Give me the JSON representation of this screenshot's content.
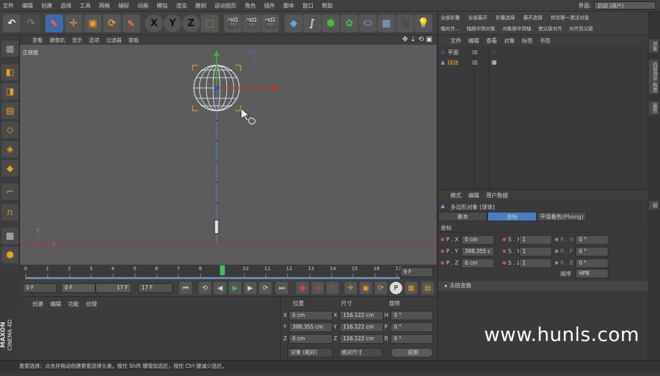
{
  "menu": [
    "文件",
    "编辑",
    "创建",
    "选择",
    "工具",
    "网格",
    "捕捉",
    "动画",
    "模拟",
    "渲染",
    "雕刻",
    "运动图形",
    "角色",
    "插件",
    "脚本",
    "窗口",
    "帮助"
  ],
  "interface": {
    "label": "界面:",
    "value": "启动 (用户)"
  },
  "toolbar_right": {
    "row1": [
      "全部折叠",
      "全部展开",
      "折叠选择",
      "展开选择",
      "转到第一激活对象"
    ],
    "row2": [
      "轴对齐...",
      "轴居中到对象",
      "对象居中到轴",
      "使父级对齐",
      "对齐到父级"
    ]
  },
  "viewport": {
    "menu": [
      "查看",
      "摄像机",
      "显示",
      "选项",
      "过滤器",
      "面板"
    ],
    "label": "正视图",
    "axis_y": "Y",
    "axis_x": "X"
  },
  "timeline": {
    "ticks": [
      "0",
      "1",
      "2",
      "3",
      "4",
      "5",
      "6",
      "7",
      "8",
      "9",
      "10",
      "11",
      "12",
      "13",
      "14",
      "15",
      "16",
      "17"
    ],
    "current": "9 F",
    "current_frame": 9
  },
  "transport": {
    "start": "0 F",
    "range_start": "0 F",
    "range_end": "17 F",
    "end": "17 F"
  },
  "material": {
    "menu": [
      "创建",
      "编辑",
      "功能",
      "纹理"
    ]
  },
  "coords": {
    "headers": [
      "位置",
      "尺寸",
      "旋转"
    ],
    "rows": [
      {
        "axis": "X",
        "pos": "0 cm",
        "size_axis": "X",
        "size": "116.122 cm",
        "rot_axis": "H",
        "rot": "0 °"
      },
      {
        "axis": "Y",
        "pos": "398.355 cm",
        "size_axis": "Y",
        "size": "116.122 cm",
        "rot_axis": "P",
        "rot": "0 °"
      },
      {
        "axis": "Z",
        "pos": "0 cm",
        "size_axis": "Z",
        "size": "116.122 cm",
        "rot_axis": "B",
        "rot": "0 °"
      }
    ],
    "mode1": "对象 (相对)",
    "mode2": "绝对尺寸",
    "apply": "应用"
  },
  "objects": {
    "menu": [
      "文件",
      "编辑",
      "查看",
      "对象",
      "标签",
      "书签"
    ],
    "items": [
      "平面",
      "球体"
    ]
  },
  "attributes": {
    "menu": [
      "模式",
      "编辑",
      "用户数据"
    ],
    "title": "多边形对象 [球体]",
    "tabs": [
      "基本",
      "坐标",
      "平滑着色(Phong)"
    ],
    "section": "坐标",
    "rows": [
      {
        "p": "P . X",
        "pv": "0 cm",
        "s": "S . X",
        "sv": "1",
        "r": "R . H",
        "rv": "0 °"
      },
      {
        "p": "P . Y",
        "pv": "398.355 c",
        "s": "S . Y",
        "sv": "1",
        "r": "R . P",
        "rv": "0 °"
      },
      {
        "p": "P . Z",
        "pv": "0 cm",
        "s": "S . Z",
        "sv": "1",
        "r": "R . B",
        "rv": "0 °"
      }
    ],
    "order_label": "顺序",
    "order_value": "HPB",
    "frozen": "冻结变换"
  },
  "right_tabs": [
    "对象",
    "内容浏览器",
    "构造",
    "属性",
    "层"
  ],
  "status": "套索选择：点击并拖动创建套索选择元素。按住 Shift 键增加选区，按住 Ctrl 键减少选区。",
  "brand": {
    "line1": "MAXON",
    "line2": "CINEMA 4D"
  },
  "watermark": "www.hunls.com",
  "colors": {
    "accent_blue": "#4a7cc0",
    "axis_red": "#d03030",
    "axis_green": "#30c030",
    "selection_orange": "#e0a020"
  }
}
